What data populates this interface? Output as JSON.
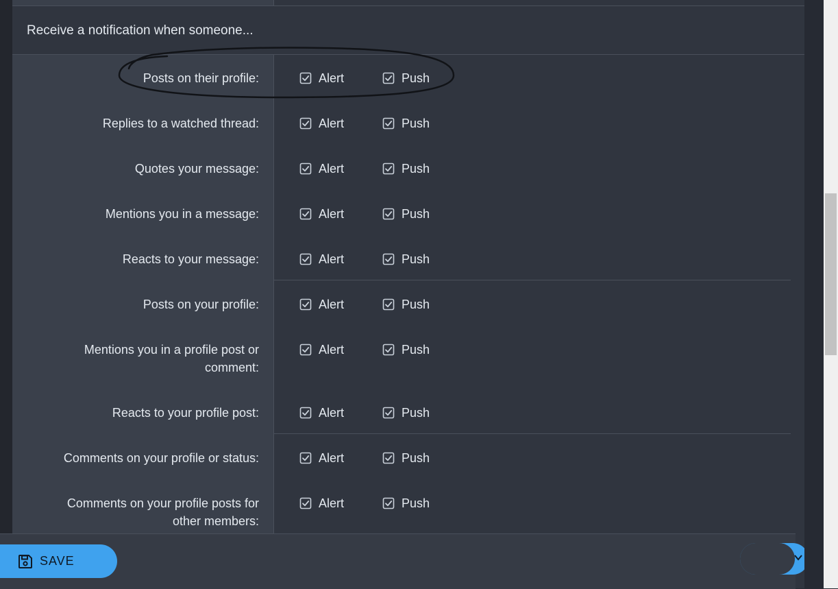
{
  "section": {
    "title": "Receive a notification when someone..."
  },
  "options": {
    "alert_label": "Alert",
    "push_label": "Push"
  },
  "rows": [
    {
      "label": "Posts on their profile:",
      "alert": true,
      "push": true
    },
    {
      "label": "Replies to a watched thread:",
      "alert": true,
      "push": true
    },
    {
      "label": "Quotes your message:",
      "alert": true,
      "push": true
    },
    {
      "label": "Mentions you in a message:",
      "alert": true,
      "push": true
    },
    {
      "label": "Reacts to your message:",
      "alert": true,
      "push": true
    },
    {
      "label": "Posts on your profile:",
      "alert": true,
      "push": true
    },
    {
      "label_lines": [
        "Mentions you in a profile post or",
        "comment:"
      ],
      "alert": true,
      "push": true
    },
    {
      "label": "Reacts to your profile post:",
      "alert": true,
      "push": true
    },
    {
      "label": "Comments on your profile or status:",
      "alert": true,
      "push": true
    },
    {
      "label_lines": [
        "Comments on your profile posts for",
        "other members:"
      ],
      "alert": true,
      "push": true
    }
  ],
  "footer": {
    "save_label": "SAVE"
  },
  "colors": {
    "accent": "#3fa2ee",
    "panel": "#30353f",
    "label_column": "#3a404b"
  },
  "icons": {
    "checkbox": "checked-box-icon",
    "save": "floppy-disk-icon",
    "fab": "chevron-down-icon"
  }
}
